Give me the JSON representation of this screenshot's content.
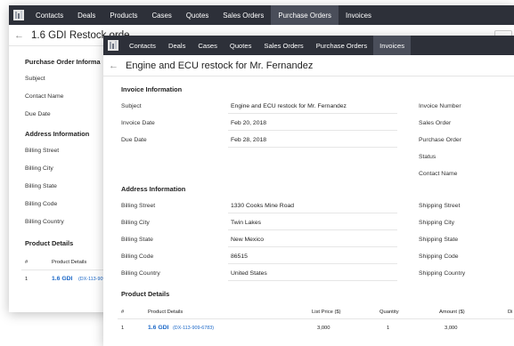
{
  "back_window": {
    "nav": [
      "Contacts",
      "Deals",
      "Products",
      "Cases",
      "Quotes",
      "Sales Orders",
      "Purchase Orders",
      "Invoices"
    ],
    "active_tab": "Purchase Orders",
    "title": "1.6 GDI Restock orde",
    "sections": {
      "po_info": "Purchase Order Informa",
      "address": "Address Information",
      "products": "Product Details"
    },
    "labels": {
      "subject": "Subject",
      "contact_name": "Contact Name",
      "due_date": "Due Date",
      "billing_street": "Billing Street",
      "billing_city": "Billing City",
      "billing_state": "Billing State",
      "billing_code": "Billing Code",
      "billing_country": "Billing Country"
    },
    "product_headers": {
      "num": "#",
      "product": "Product Details"
    },
    "product_row": {
      "num": "1",
      "name": "1.6 GDI",
      "code": "(DX-113-909"
    }
  },
  "front_window": {
    "nav": [
      "Contacts",
      "Deals",
      "Cases",
      "Quotes",
      "Sales Orders",
      "Purchase Orders",
      "Invoices"
    ],
    "active_tab": "Invoices",
    "title": "Engine and ECU restock for Mr. Fernandez",
    "invoice_info": {
      "heading": "Invoice Information",
      "rows": [
        {
          "label": "Subject",
          "value": "Engine and ECU restock for Mr. Fernandez"
        },
        {
          "label": "Invoice Date",
          "value": "Feb 20, 2018"
        },
        {
          "label": "Due Date",
          "value": "Feb 28, 2018"
        }
      ],
      "right_labels": [
        "Invoice Number",
        "Sales Order",
        "Purchase Order",
        "Status",
        "Contact Name"
      ]
    },
    "address_info": {
      "heading": "Address Information",
      "rows": [
        {
          "label": "Billing Street",
          "value": "1330 Cooks Mine Road"
        },
        {
          "label": "Billing City",
          "value": "Twin Lakes"
        },
        {
          "label": "Billing State",
          "value": "New Mexico"
        },
        {
          "label": "Billing Code",
          "value": "86515"
        },
        {
          "label": "Billing Country",
          "value": "United States"
        }
      ],
      "right_labels": [
        "Shipping Street",
        "Shipping City",
        "Shipping State",
        "Shipping Code",
        "Shipping Country"
      ]
    },
    "product_details": {
      "heading": "Product Details",
      "headers": {
        "num": "#",
        "product": "Product Details",
        "list_price": "List Price ($)",
        "quantity": "Quantity",
        "amount": "Amount ($)",
        "extra": "Di"
      },
      "row": {
        "num": "1",
        "name": "1.6 GDI",
        "code": "(DX-113-909-6783)",
        "list_price": "3,000",
        "quantity": "1",
        "amount": "3,000"
      }
    }
  },
  "colors": {
    "nav_bg": "#2d3039",
    "nav_active": "#4a4e5a",
    "link": "#1a67c7"
  },
  "icons": [
    "app-logo-icon",
    "back-arrow-icon"
  ]
}
